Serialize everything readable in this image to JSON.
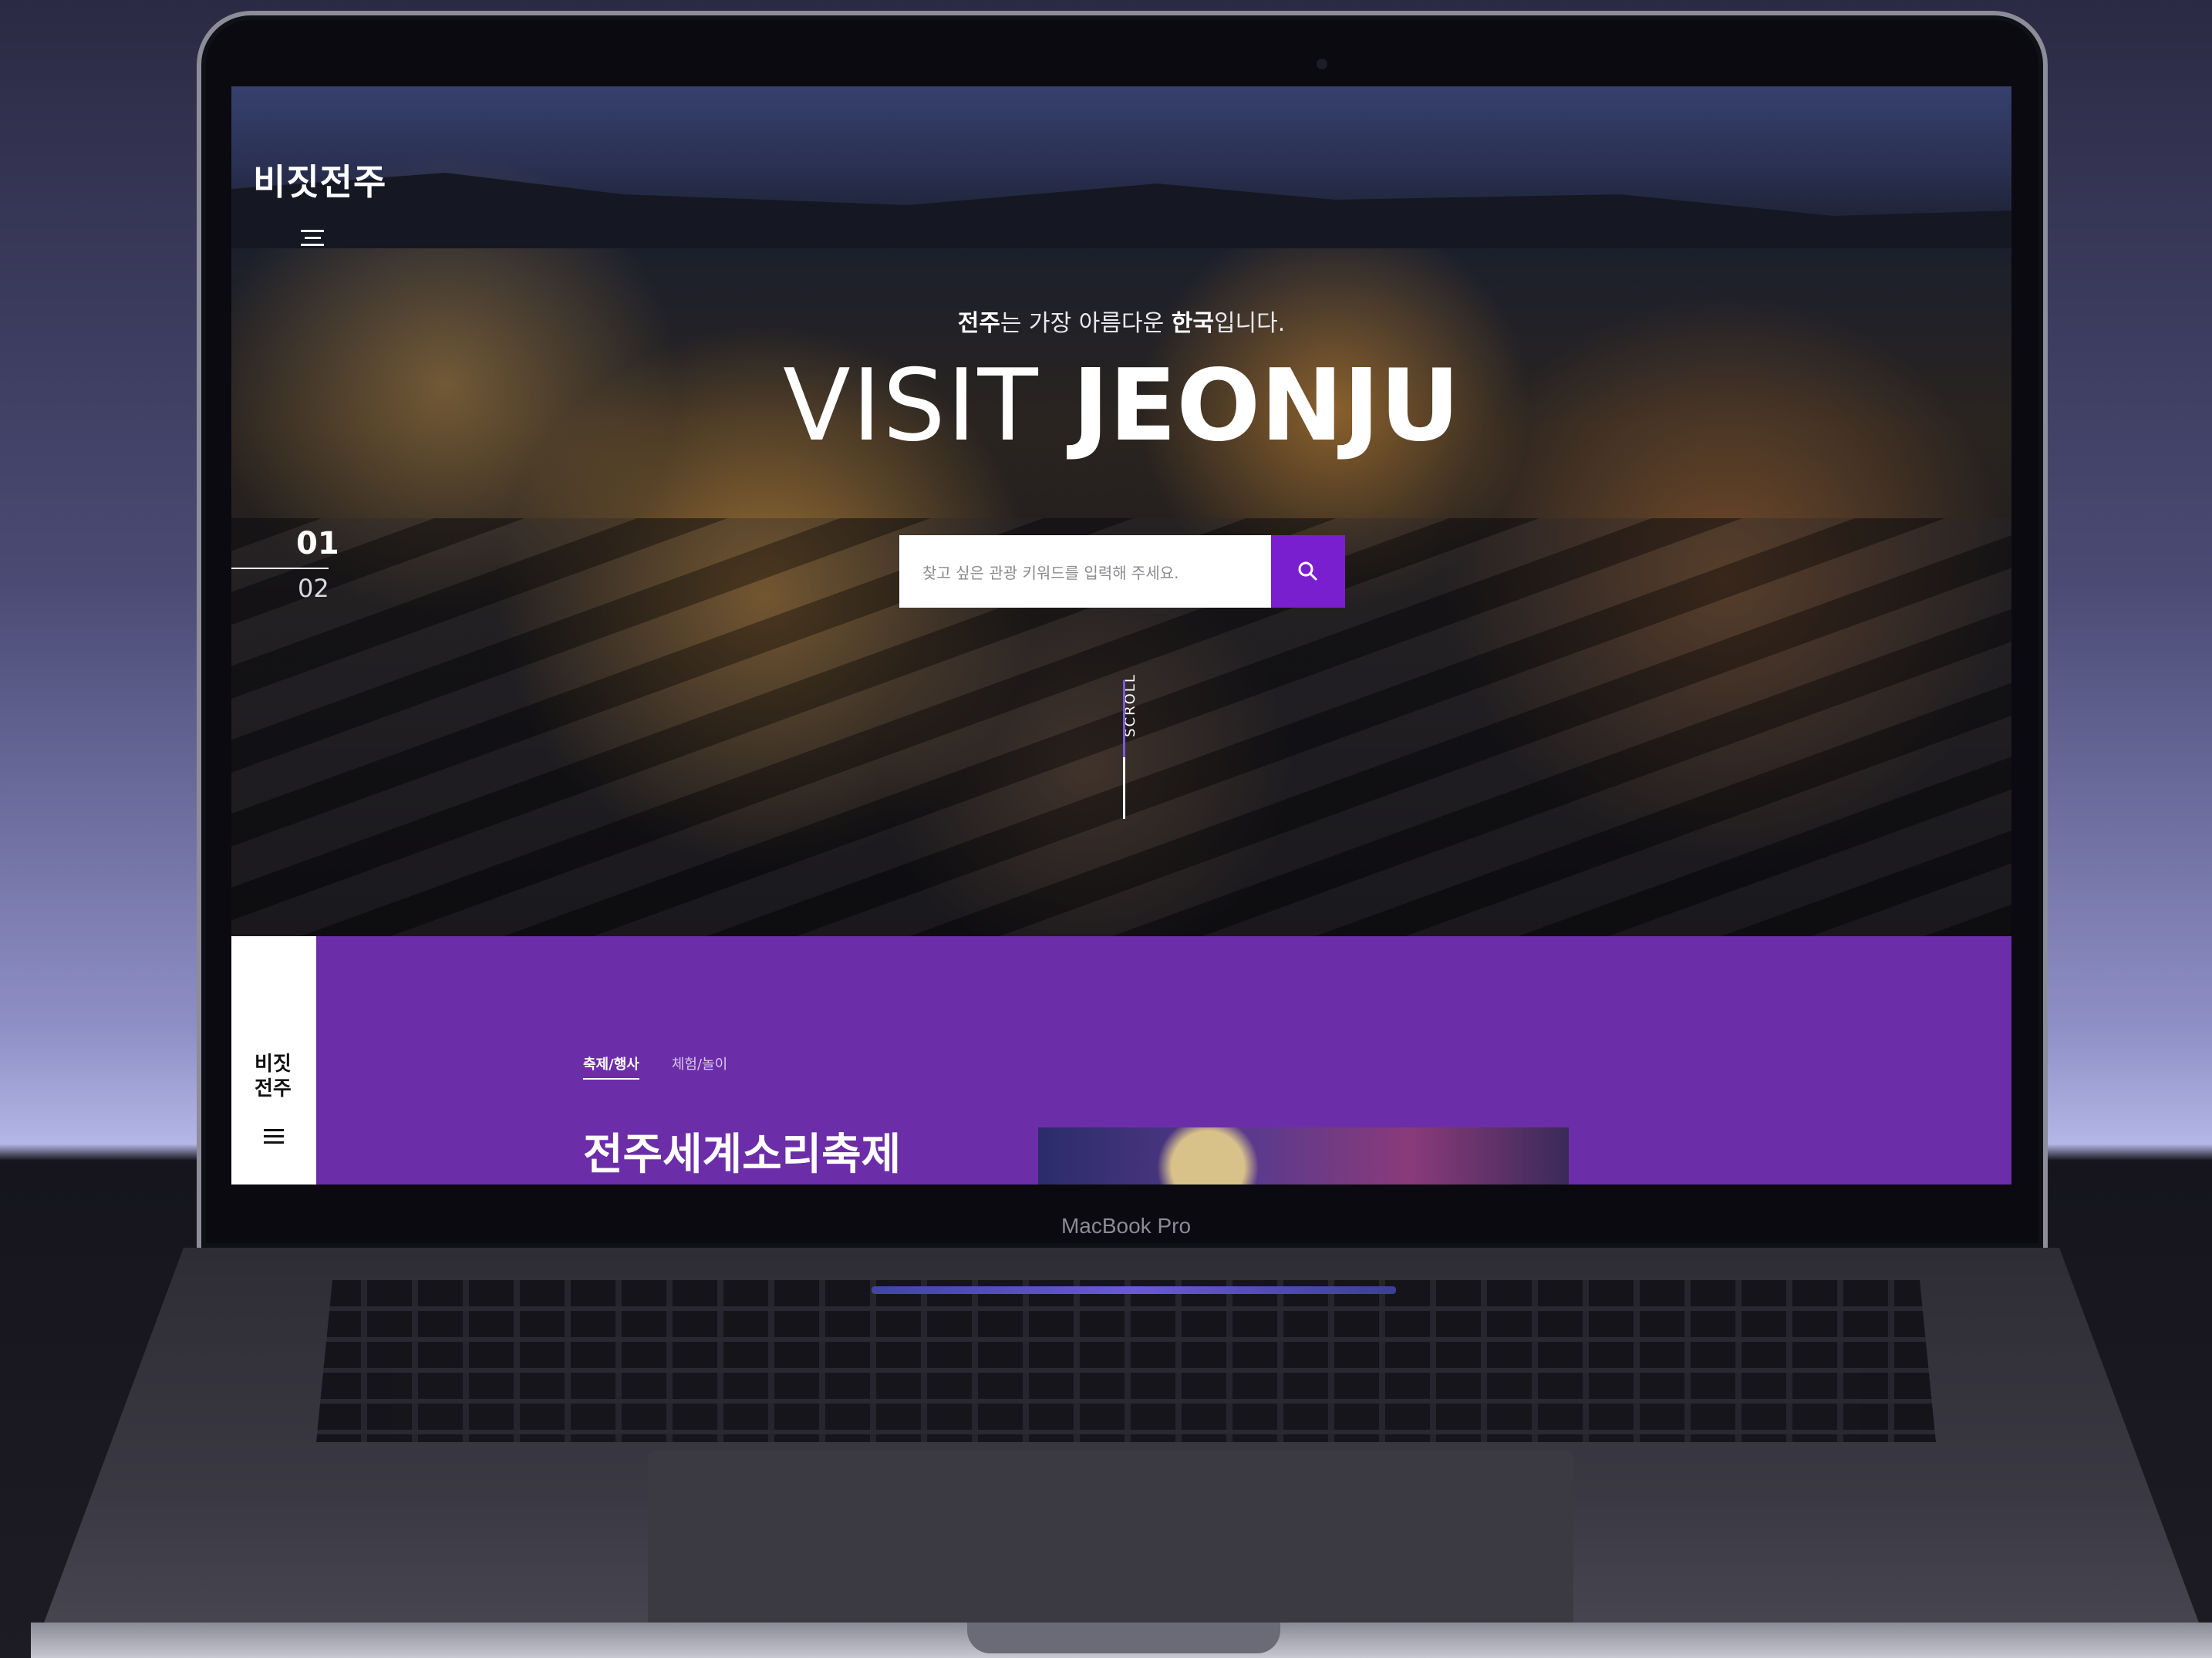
{
  "device": {
    "label": "MacBook Pro"
  },
  "site": {
    "logo": "비짓전주",
    "menu_icon": "hamburger-icon",
    "hero": {
      "tagline_strong_1": "전주",
      "tagline_mid": "는 가장 아름다운 ",
      "tagline_strong_2": "한국",
      "tagline_end": "입니다.",
      "headline_thin": "VISIT ",
      "headline_bold": "JEONJU",
      "slide_current": "01",
      "slide_next": "02",
      "search_placeholder": "찾고 싶은 관광 키워드를 입력해 주세요.",
      "search_icon": "search-icon",
      "scroll_label": "SCROLL"
    },
    "section": {
      "side_logo_line1": "비짓",
      "side_logo_line2": "전주",
      "tabs": [
        {
          "label": "축제/행사",
          "active": true
        },
        {
          "label": "체험/놀이",
          "active": false
        }
      ],
      "festival_title": "전주세계소리축제"
    }
  },
  "colors": {
    "accent": "#7a1fd0",
    "section_bg": "#6c2ea8"
  }
}
